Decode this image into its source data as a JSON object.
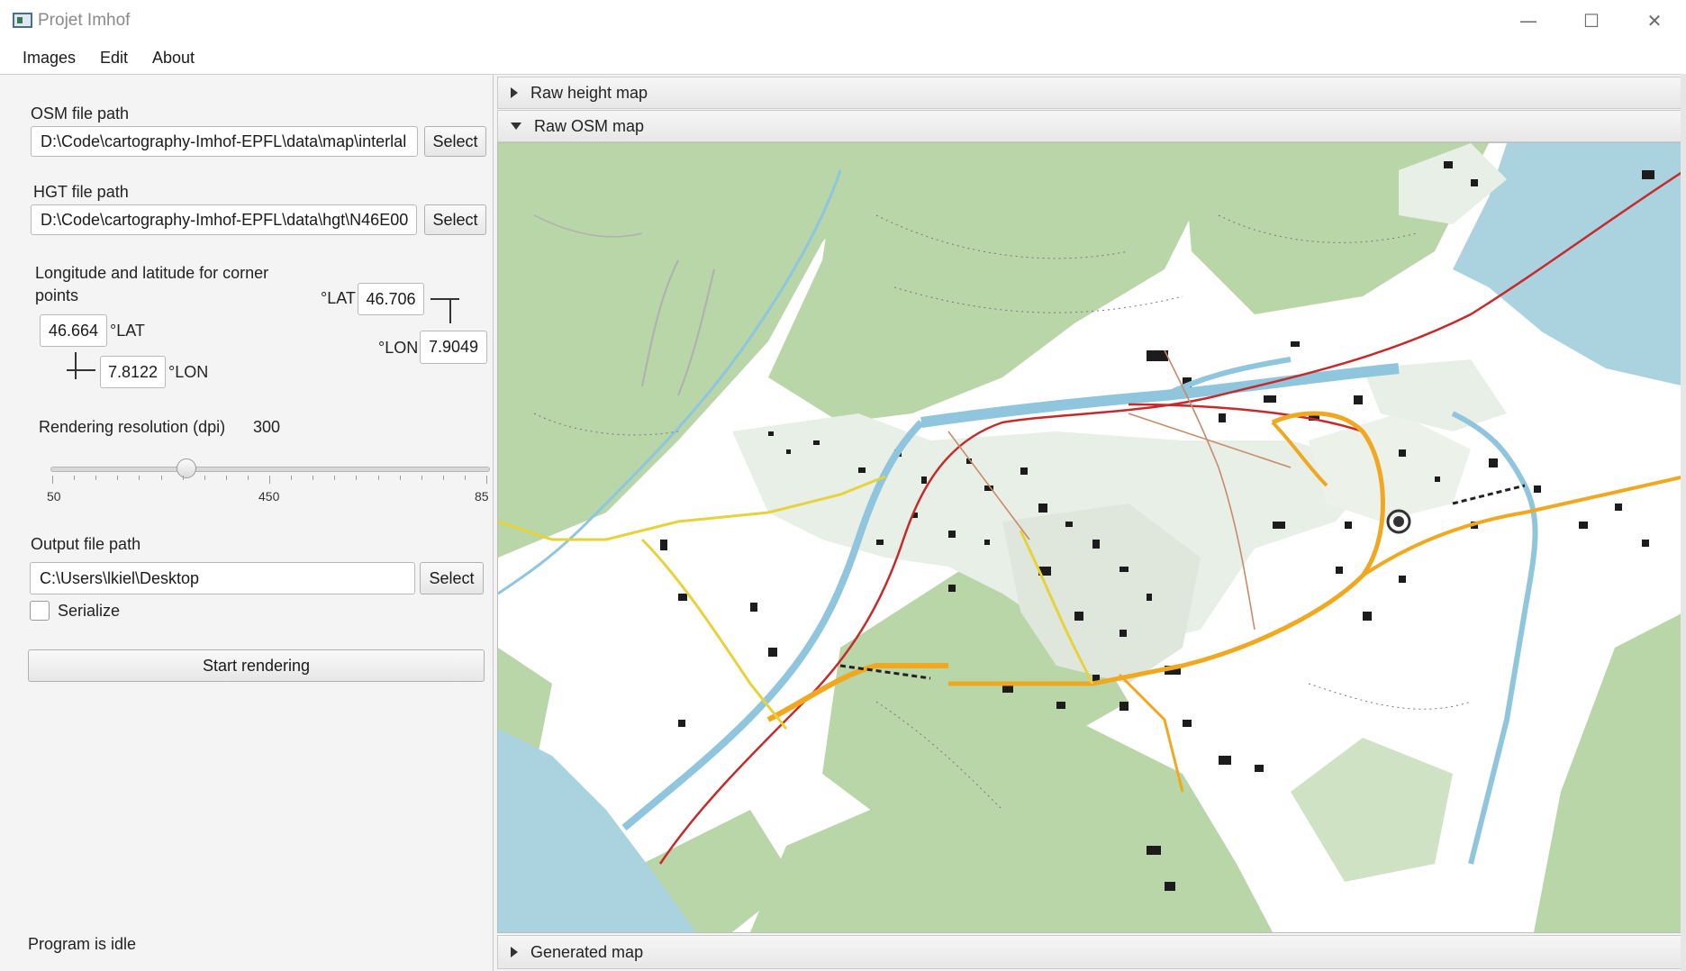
{
  "window": {
    "title": "Projet Imhof",
    "minimize_glyph": "—",
    "maximize_glyph": "☐",
    "close_glyph": "✕"
  },
  "menu": [
    "Images",
    "Edit",
    "About"
  ],
  "left": {
    "osm_label": "OSM file path",
    "osm_value": "D:\\Code\\cartography-Imhof-EPFL\\data\\map\\interlal",
    "hgt_label": "HGT file path",
    "hgt_value": "D:\\Code\\cartography-Imhof-EPFL\\data\\hgt\\N46E00",
    "select_label": "Select",
    "coords_label_line1": "Longitude and latitude for corner",
    "coords_label_line2": "points",
    "bottom_left": {
      "lat": "46.664",
      "lon": "7.8122"
    },
    "top_right": {
      "lat": "46.706",
      "lon": "7.9049"
    },
    "lat_unit": "°LAT",
    "lon_unit": "°LON",
    "resolution_label": "Rendering resolution (dpi)",
    "resolution_value": "300",
    "slider": {
      "min": 50,
      "mid": 450,
      "max_label": "85",
      "value": 300,
      "fraction": 0.31
    },
    "tick_labels": [
      "50",
      "450",
      "85"
    ],
    "output_label": "Output file path",
    "output_value": "C:\\Users\\lkiel\\Desktop",
    "serialize_label": "Serialize",
    "serialize_checked": false,
    "start_label": "Start rendering",
    "status": "Program is idle"
  },
  "right": {
    "panels": [
      {
        "label": "Raw height map",
        "expanded": false
      },
      {
        "label": "Raw OSM map",
        "expanded": true
      },
      {
        "label": "Generated map",
        "expanded": false
      }
    ]
  },
  "colors": {
    "forest": "#b8d6a8",
    "water": "#aad3df",
    "river": "#8fc6de",
    "road_major": "#f0a821",
    "road_yellow": "#e6d23a",
    "rail": "#c62a2a",
    "urban": "#e8efe6",
    "building": "#1c1c1c"
  }
}
